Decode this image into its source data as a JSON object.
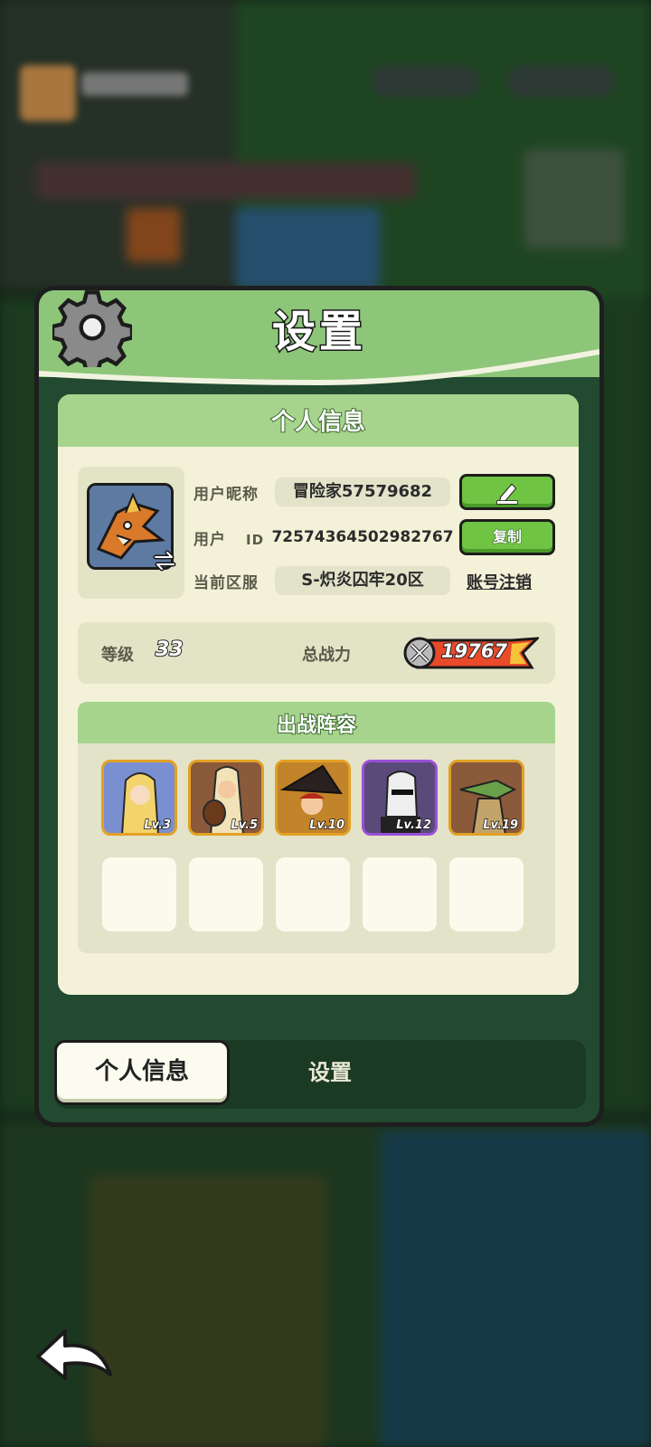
{
  "dialog": {
    "title": "设置",
    "icon": "gear-icon"
  },
  "profile": {
    "header": "个人信息",
    "nickname_label": "用户昵称",
    "nickname_value": "冒险家57579682",
    "edit_icon": "pencil-icon",
    "user_id_label_a": "用户",
    "user_id_label_b": "ID",
    "user_id_value": "72574364502982767",
    "copy_label": "复制",
    "server_label": "当前区服",
    "server_value": "S-炽炎囚牢20区",
    "delete_account_label": "账号注销",
    "level_label": "等级",
    "level_value": "33",
    "power_label": "总战力",
    "power_value": "19767"
  },
  "lineup": {
    "header": "出战阵容",
    "heroes": [
      {
        "level": "Lv.3",
        "color": "#e8c27a",
        "frame": "#e3a024"
      },
      {
        "level": "Lv.5",
        "color": "#c48a5a",
        "frame": "#e3a024"
      },
      {
        "level": "Lv.10",
        "color": "#8a3a2a",
        "frame": "#e3a024"
      },
      {
        "level": "Lv.12",
        "color": "#4a4060",
        "frame": "#9a4fd8"
      },
      {
        "level": "Lv.19",
        "color": "#7a6a3a",
        "frame": "#e3a024"
      }
    ],
    "empty_slots": 5
  },
  "tabs": {
    "active": "个人信息",
    "inactive": "设置"
  },
  "navigation": {
    "back_icon": "back-arrow-icon"
  },
  "colors": {
    "header_green": "#8dc579",
    "button_green": "#6fc443",
    "card_bg": "#f3f2d8"
  }
}
